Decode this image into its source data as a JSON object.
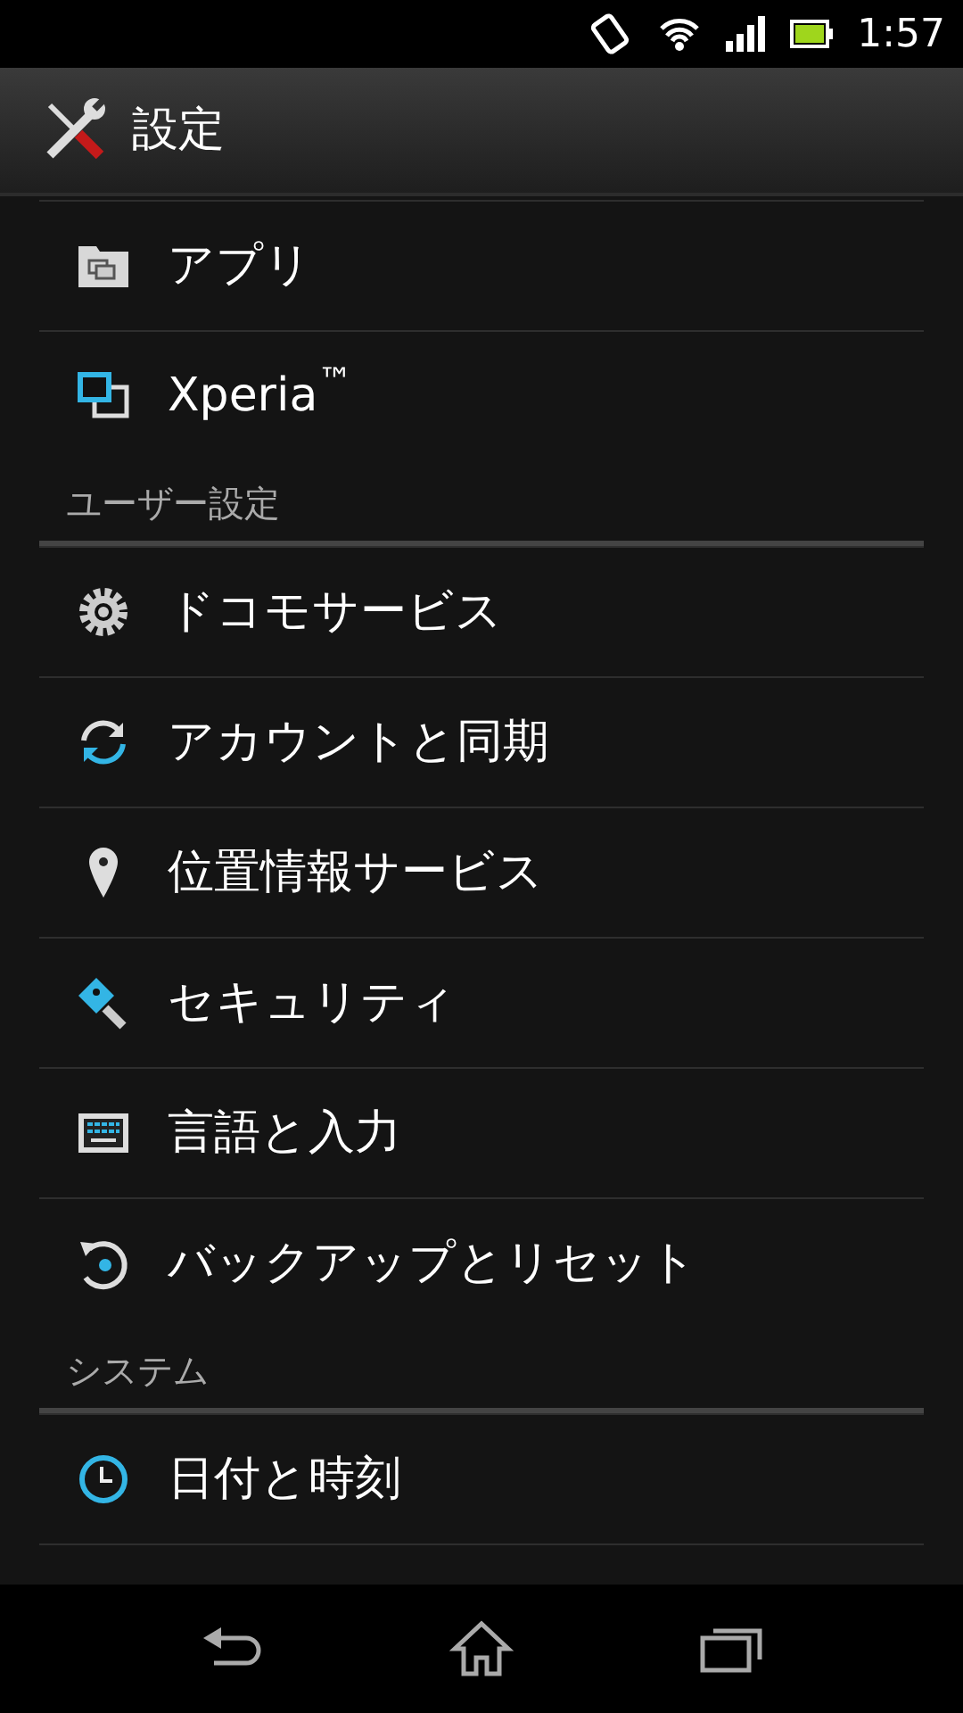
{
  "status_bar": {
    "time": "1:57"
  },
  "action_bar": {
    "title": "設定"
  },
  "list": [
    {
      "kind": "item",
      "label": "アプリ"
    },
    {
      "kind": "item",
      "label": "Xperia$^{™}$"
    },
    {
      "kind": "header",
      "label": "ユーザー設定"
    },
    {
      "kind": "item",
      "label": "ドコモサービス"
    },
    {
      "kind": "item",
      "label": "アカウントと同期"
    },
    {
      "kind": "item",
      "label": "位置情報サービス"
    },
    {
      "kind": "item",
      "label": "セキュリティ"
    },
    {
      "kind": "item",
      "label": "言語と入力"
    },
    {
      "kind": "item",
      "label": "バックアップとリセット"
    },
    {
      "kind": "header",
      "label": "システム"
    },
    {
      "kind": "item",
      "label": "日付と時刻"
    }
  ]
}
